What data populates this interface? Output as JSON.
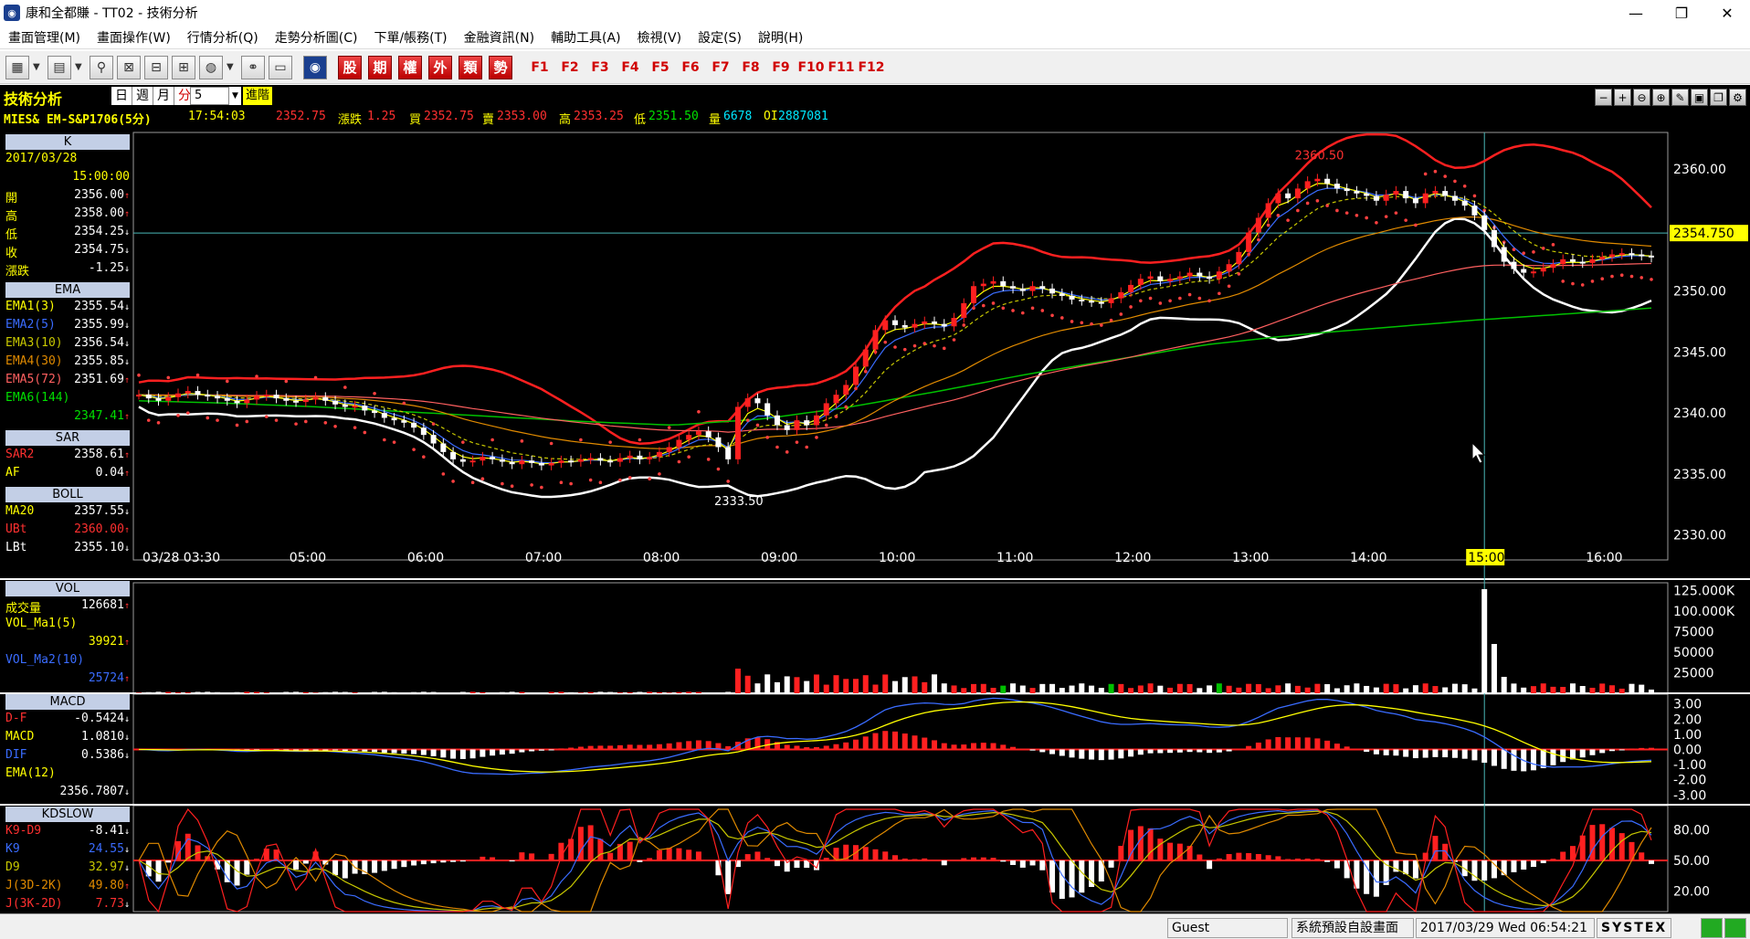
{
  "window": {
    "title": "康和全都賺 - TT02 - 技術分析",
    "minimize": "—",
    "restore": "❐",
    "close": "✕"
  },
  "menu": [
    "畫面管理(M)",
    "畫面操作(W)",
    "行情分析(Q)",
    "走勢分析圖(C)",
    "下單/帳務(T)",
    "金融資訊(N)",
    "輔助工具(A)",
    "檢視(V)",
    "設定(S)",
    "說明(H)"
  ],
  "toolbar": {
    "cn_buttons": [
      "股",
      "期",
      "權",
      "外",
      "類",
      "勢"
    ],
    "f_keys": [
      "F1",
      "F2",
      "F3",
      "F4",
      "F5",
      "F6",
      "F7",
      "F8",
      "F9",
      "F10",
      "F11",
      "F12"
    ]
  },
  "chart_header": {
    "panel_title": "技術分析",
    "timeframes": [
      "日",
      "週",
      "月",
      "分"
    ],
    "period_value": "5",
    "advance_label": "進階",
    "symbol": "MIES&  EM-S&P1706(5分)",
    "time": "17:54:03",
    "last": "2352.75",
    "change_label": "漲跌",
    "change": "1.25",
    "bid_label": "買",
    "bid": "2352.75",
    "ask_label": "賣",
    "ask": "2353.00",
    "high_label": "高",
    "high": "2353.25",
    "low_label": "低",
    "low": "2351.50",
    "vol_label": "量",
    "vol": "6678",
    "oi_label": "OI",
    "oi": "2887081"
  },
  "colors": {
    "red": "#ff2020",
    "white": "#ffffff",
    "yellow": "#ffff00",
    "green": "#00c000",
    "blue": "#3a6cff",
    "orange": "#e08a00",
    "olive": "#c8c800",
    "gray_grid": "#3a3a3a",
    "panel_head": "#c3cfe6",
    "price_tag": "#00e8ff"
  },
  "side": {
    "k_title": "K",
    "k_date": "2017/03/28",
    "k_time": "15:00:00",
    "k_rows": [
      {
        "label": "開",
        "value": "2356.00",
        "dir": "up"
      },
      {
        "label": "高",
        "value": "2358.00",
        "dir": "up"
      },
      {
        "label": "低",
        "value": "2354.25",
        "dir": "dn"
      },
      {
        "label": "收",
        "value": "2354.75",
        "dir": "dn"
      },
      {
        "label": "漲跌",
        "value": "-1.25",
        "dir": "dn"
      }
    ],
    "ema_title": "EMA",
    "ema_rows": [
      {
        "label": "EMA1(3)",
        "value": "2355.54",
        "dir": "dn",
        "color": "#ffff00"
      },
      {
        "label": "EMA2(5)",
        "value": "2355.99",
        "dir": "dn",
        "color": "#3a6cff"
      },
      {
        "label": "EMA3(10)",
        "value": "2356.54",
        "dir": "dn",
        "color": "#c8c800"
      },
      {
        "label": "EMA4(30)",
        "value": "2355.85",
        "dir": "dn",
        "color": "#e08a00"
      },
      {
        "label": "EMA5(72)",
        "value": "2351.69",
        "dir": "up",
        "color": "#ff6060"
      }
    ],
    "ema6_label": "EMA6(144)",
    "ema6_value": "2347.41",
    "sar_title": "SAR",
    "sar_rows": [
      {
        "label": "SAR2",
        "value": "2358.61",
        "dir": "up",
        "color": "#ff3030"
      },
      {
        "label": "AF",
        "value": "0.04",
        "dir": "up",
        "color": "#ff3030"
      }
    ],
    "boll_title": "BOLL",
    "boll_rows": [
      {
        "label": "MA20",
        "value": "2357.55",
        "dir": "dn",
        "color": "#ffff00"
      },
      {
        "label": "UBt",
        "value": "2360.00",
        "dir": "up",
        "color": "#ff3030"
      },
      {
        "label": "LBt",
        "value": "2355.10",
        "dir": "dn",
        "color": "#ffffff"
      }
    ],
    "vol_title": "VOL",
    "vol_label": "成交量",
    "vol_value": "126681",
    "vol_ma1_label": "VOL_Ma1(5)",
    "vol_ma1_value": "39921",
    "vol_ma2_label": "VOL_Ma2(10)",
    "vol_ma2_value": "25724",
    "macd_title": "MACD",
    "macd_rows": [
      {
        "label": "D-F",
        "value": "-0.5424",
        "dir": "dn",
        "color": "#ff3030"
      },
      {
        "label": "MACD",
        "value": "1.0810",
        "dir": "dn",
        "color": "#ffff00"
      },
      {
        "label": "DIF",
        "value": "0.5386",
        "dir": "dn",
        "color": "#3a6cff"
      }
    ],
    "macd_ema_label": "EMA(12)",
    "macd_ema_value": "2356.7807",
    "kd_title": "KDSLOW",
    "kd_rows": [
      {
        "label": "K9-D9",
        "value": "-8.41",
        "dir": "dn",
        "color": "#ff3030"
      },
      {
        "label": "K9",
        "value": "24.55",
        "dir": "dn",
        "color": "#3a6cff"
      },
      {
        "label": "D9",
        "value": "32.97",
        "dir": "dn",
        "color": "#c8c800"
      },
      {
        "label": "J(3D-2K)",
        "value": "49.80",
        "dir": "up",
        "color": "#e08a00"
      },
      {
        "label": "J(3K-2D)",
        "value": "7.73",
        "dir": "dn",
        "color": "#ff3030"
      }
    ]
  },
  "chart_data": [
    {
      "type": "candlestick",
      "x_ticks": [
        "03/28 03:30",
        "05:00",
        "06:00",
        "07:00",
        "08:00",
        "09:00",
        "10:00",
        "11:00",
        "12:00",
        "13:00",
        "14:00",
        "15:00",
        "16:00"
      ],
      "y_ticks": [
        "2360.00",
        "2355.00",
        "2350.00",
        "2345.00",
        "2340.00",
        "2335.00",
        "2330.00"
      ],
      "ylim": [
        2329,
        2363
      ],
      "current_price_tag": "2354.750",
      "high_label": "2360.50",
      "low_label": "2333.50",
      "close": [
        2341.5,
        2341.2,
        2341.0,
        2341.3,
        2341.6,
        2341.8,
        2341.5,
        2341.4,
        2341.2,
        2341.0,
        2340.8,
        2341.1,
        2341.4,
        2341.5,
        2341.2,
        2341.0,
        2340.9,
        2341.1,
        2341.3,
        2341.0,
        2340.7,
        2340.5,
        2340.6,
        2340.2,
        2340.0,
        2339.6,
        2339.4,
        2339.2,
        2338.8,
        2338.2,
        2337.5,
        2336.8,
        2336.2,
        2336.0,
        2336.1,
        2336.4,
        2336.2,
        2336.0,
        2335.8,
        2336.1,
        2335.9,
        2335.7,
        2335.9,
        2336.1,
        2336.0,
        2336.2,
        2336.3,
        2336.1,
        2336.0,
        2336.3,
        2336.5,
        2336.2,
        2336.4,
        2336.8,
        2337.2,
        2337.8,
        2338.2,
        2338.5,
        2338.0,
        2337.2,
        2336.2,
        2340.5,
        2341.2,
        2340.8,
        2339.8,
        2339.0,
        2338.6,
        2339.4,
        2339.0,
        2339.8,
        2340.8,
        2341.5,
        2342.3,
        2343.8,
        2345.2,
        2346.8,
        2347.6,
        2347.2,
        2347.0,
        2347.3,
        2347.5,
        2347.3,
        2347.1,
        2347.8,
        2349.0,
        2350.4,
        2350.6,
        2350.8,
        2350.4,
        2350.2,
        2350.0,
        2350.4,
        2350.2,
        2349.8,
        2349.6,
        2349.3,
        2349.2,
        2349.1,
        2349.0,
        2349.4,
        2349.9,
        2350.5,
        2351.0,
        2351.2,
        2350.8,
        2351.0,
        2351.2,
        2351.5,
        2351.2,
        2351.0,
        2351.6,
        2352.2,
        2353.2,
        2354.8,
        2356.0,
        2357.2,
        2358.0,
        2357.6,
        2358.4,
        2359.0,
        2359.2,
        2358.8,
        2358.4,
        2358.2,
        2358.0,
        2357.8,
        2357.4,
        2357.9,
        2358.2,
        2357.6,
        2357.2,
        2358.0,
        2358.2,
        2357.8,
        2357.4,
        2357.0,
        2356.2,
        2355.0,
        2353.6,
        2352.4,
        2351.8,
        2351.5,
        2351.6,
        2351.9,
        2352.2,
        2352.6,
        2352.4,
        2352.3,
        2352.6,
        2352.8,
        2353.0,
        2353.1,
        2353.0,
        2352.9,
        2352.75
      ],
      "ema144": [
        2341.0,
        2340.8,
        2340.5,
        2340.1,
        2339.7,
        2339.3,
        2339.0,
        2339.5,
        2340.5,
        2341.8,
        2343.2,
        2344.4,
        2345.6,
        2346.4,
        2347.0,
        2347.6,
        2348.1,
        2348.6
      ]
    },
    {
      "type": "bar",
      "title": "VOL",
      "y_ticks": [
        "125.000K",
        "100.000K",
        "75000",
        "50000",
        "25000"
      ],
      "ylim": [
        0,
        130000
      ],
      "peak_at_1500": 126681
    },
    {
      "type": "bar",
      "title": "MACD",
      "y_ticks": [
        "3.00",
        "2.00",
        "1.00",
        "0.00",
        "-1.00",
        "-2.00",
        "-3.00"
      ],
      "ylim": [
        -3.4,
        3.4
      ]
    },
    {
      "type": "line",
      "title": "KDSLOW",
      "y_ticks": [
        "80.00",
        "50.00",
        "20.00"
      ],
      "ylim": [
        0,
        100
      ]
    }
  ],
  "status": {
    "user": "Guest",
    "layout": "系統預設自設畫面",
    "datetime": "2017/03/29 Wed 06:54:21",
    "brand": "SYSTEX"
  }
}
